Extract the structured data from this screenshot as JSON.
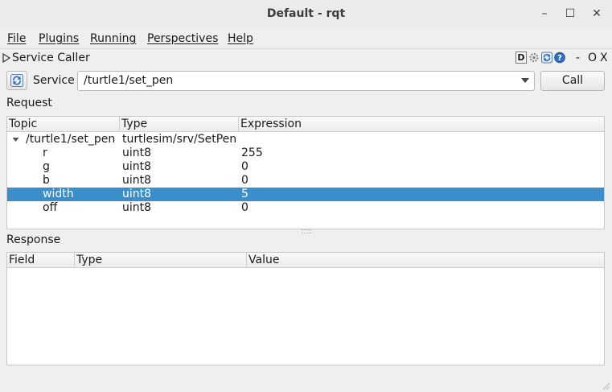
{
  "window": {
    "title": "Default - rqt",
    "controls": {
      "minimize": "–",
      "maximize": "☐",
      "close": "✕"
    }
  },
  "menubar": [
    "File",
    "Plugins",
    "Running",
    "Perspectives",
    "Help"
  ],
  "plugin": {
    "title": "Service Caller",
    "header_icons": [
      "d-icon",
      "gear-icon",
      "reload-icon",
      "help-icon"
    ],
    "header_controls": {
      "minimize": "-",
      "float": "O",
      "close": "X"
    }
  },
  "service": {
    "label": "Service",
    "selected": "/turtle1/set_pen",
    "call_label": "Call"
  },
  "request": {
    "label": "Request",
    "columns": [
      "Topic",
      "Type",
      "Expression"
    ],
    "root": {
      "topic": "/turtle1/set_pen",
      "type": "turtlesim/srv/SetPen",
      "expression": ""
    },
    "rows": [
      {
        "topic": "r",
        "type": "uint8",
        "expression": "255",
        "selected": false
      },
      {
        "topic": "g",
        "type": "uint8",
        "expression": "0",
        "selected": false
      },
      {
        "topic": "b",
        "type": "uint8",
        "expression": "0",
        "selected": false
      },
      {
        "topic": "width",
        "type": "uint8",
        "expression": "5",
        "selected": true
      },
      {
        "topic": "off",
        "type": "uint8",
        "expression": "0",
        "selected": false
      }
    ]
  },
  "response": {
    "label": "Response",
    "columns": [
      "Field",
      "Type",
      "Value"
    ]
  },
  "colors": {
    "selection": "#3a8fcb",
    "window_bg": "#efefef"
  }
}
